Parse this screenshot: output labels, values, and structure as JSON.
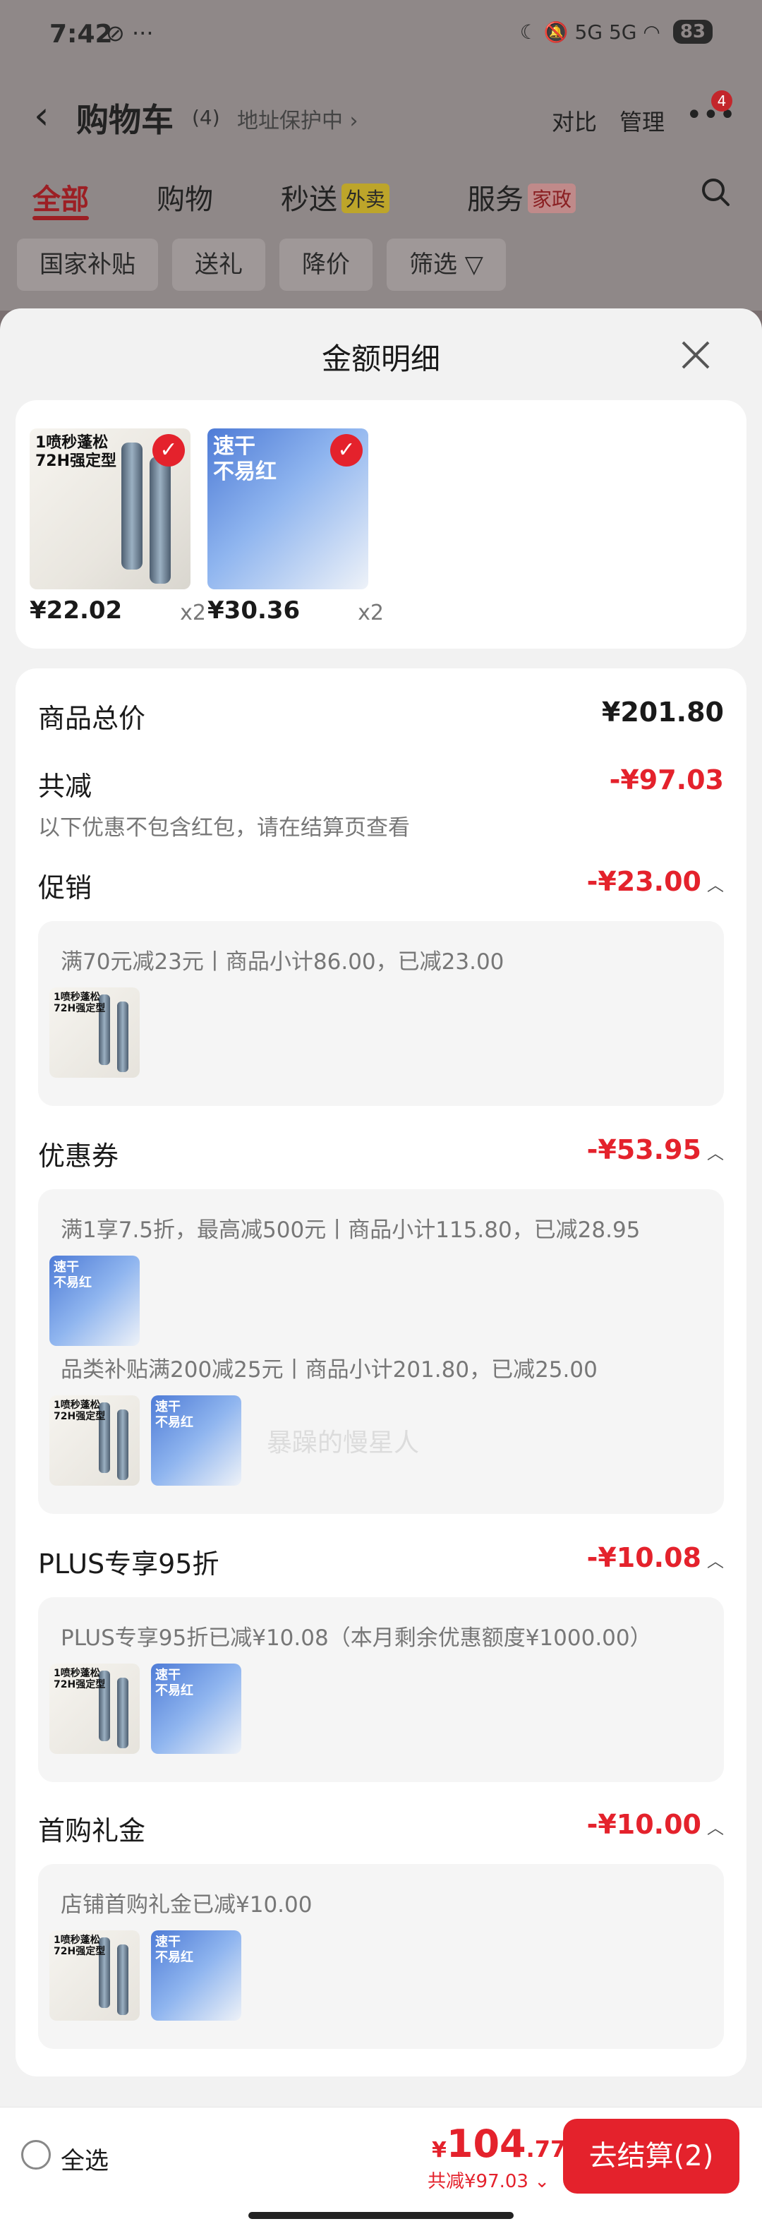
{
  "status_bar": {
    "time": "7:42",
    "left_icons": "⊘ ···",
    "right_icons": "☾ 🔕 5G 5G ◠",
    "battery": "83"
  },
  "nav": {
    "title": "购物车",
    "count": "(4)",
    "address": "地址保护中 ›",
    "compare": "对比",
    "manage": "管理",
    "more_badge": "4"
  },
  "tabs": {
    "all": "全部",
    "shopping": "购物",
    "express": "秒送",
    "express_tag": "外卖",
    "service": "服务",
    "service_tag": "家政"
  },
  "chips": [
    "国家补贴",
    "送礼",
    "降价",
    "筛选 ▽"
  ],
  "sheet": {
    "title": "金额明细"
  },
  "products": [
    {
      "name": "gel",
      "text": "1喷秒蓬松\n72H强定型",
      "price": "¥22.02",
      "qty": "x2"
    },
    {
      "name": "diaper",
      "text": "速干\n不易红",
      "price": "¥30.36",
      "qty": "x2"
    }
  ],
  "summary": {
    "total_label": "商品总价",
    "total_value": "¥201.80",
    "reduce_label": "共减",
    "reduce_value": "-¥97.03",
    "note": "以下优惠不包含红包，请在结算页查看"
  },
  "sections": {
    "promo": {
      "label": "促销",
      "value": "-¥23.00",
      "line1": "满70元减23元丨商品小计86.00，已减23.00"
    },
    "coupon": {
      "label": "优惠券",
      "value": "-¥53.95",
      "line1": "满1享7.5折，最高减500元丨商品小计115.80，已减28.95",
      "line2": "品类补贴满200减25元丨商品小计201.80，已减25.00"
    },
    "plus": {
      "label": "PLUS专享95折",
      "value": "-¥10.08",
      "line1": "PLUS专享95折已减¥10.08（本月剩余优惠额度¥1000.00）"
    },
    "first": {
      "label": "首购礼金",
      "value": "-¥10.00",
      "line1": "店铺首购礼金已减¥10.00"
    }
  },
  "watermark": "暴躁的慢星人",
  "bottom": {
    "select_all": "全选",
    "currency": "¥",
    "total_int": "104",
    "total_dec": ".77",
    "saved": "共减¥97.03 ⌄",
    "checkout": "去结算(2)"
  },
  "colors": {
    "accent_red": "#e4222c",
    "sheet_bg": "#f2f2f2"
  }
}
